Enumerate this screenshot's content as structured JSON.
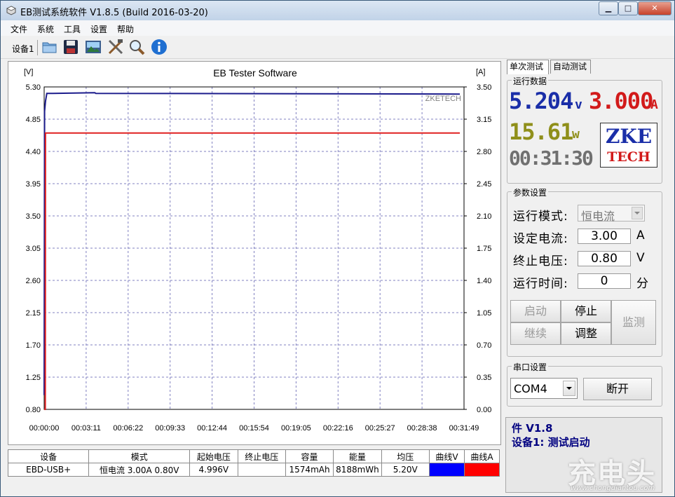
{
  "window": {
    "title": "EB测试系统软件 V1.8.5 (Build 2016-03-20)",
    "controls": {
      "minimize": "▁",
      "maximize": "□",
      "close": "✕"
    }
  },
  "menu": [
    "文件",
    "系统",
    "工具",
    "设置",
    "帮助"
  ],
  "toolbar": {
    "device_label": "设备1",
    "icons": [
      "open-folder-icon",
      "save-disk-icon",
      "picture-icon",
      "tools-icon",
      "magnifier-icon",
      "info-icon"
    ]
  },
  "chart_data": {
    "type": "line",
    "title": "EB Tester Software",
    "watermark": "ZKETECH",
    "left_axis": {
      "unit": "[V]",
      "ticks": [
        "5.30",
        "4.85",
        "4.40",
        "3.95",
        "3.50",
        "3.05",
        "2.60",
        "2.15",
        "1.70",
        "1.25",
        "0.80"
      ],
      "range": [
        0.8,
        5.3
      ]
    },
    "right_axis": {
      "unit": "[A]",
      "ticks": [
        "3.50",
        "3.15",
        "2.80",
        "2.45",
        "2.10",
        "1.75",
        "1.40",
        "1.05",
        "0.70",
        "0.35",
        "0.00"
      ],
      "range": [
        0.0,
        3.5
      ]
    },
    "x_ticks": [
      "00:00:00",
      "00:03:11",
      "00:06:22",
      "00:09:33",
      "00:12:44",
      "00:15:54",
      "00:19:05",
      "00:22:16",
      "00:25:27",
      "00:28:38",
      "00:31:49"
    ],
    "x_range_seconds": [
      0,
      1909
    ],
    "series": [
      {
        "axis": "left",
        "color": "#1c1c8c",
        "points": [
          [
            0,
            1.0
          ],
          [
            2,
            4.96
          ],
          [
            6,
            5.1
          ],
          [
            12,
            5.21
          ],
          [
            40,
            5.21
          ],
          [
            230,
            5.22
          ],
          [
            235,
            5.21
          ],
          [
            1890,
            5.2
          ]
        ]
      },
      {
        "axis": "right",
        "color": "#e02020",
        "points": [
          [
            0,
            0.0
          ],
          [
            5,
            0.0
          ],
          [
            6,
            3.0
          ],
          [
            1890,
            3.0
          ]
        ]
      }
    ]
  },
  "table": {
    "headers": [
      "设备",
      "模式",
      "起始电压",
      "终止电压",
      "容量",
      "能量",
      "均压",
      "曲线V",
      "曲线A"
    ],
    "row": [
      "EBD-USB+",
      "恒电流  3.00A  0.80V",
      "4.996V",
      "",
      "1574mAh",
      "8188mWh",
      "5.20V",
      "",
      ""
    ],
    "curve_colors": {
      "v": "#0000ff",
      "a": "#ff0000"
    }
  },
  "right_panel": {
    "tabs": [
      "单次测试",
      "自动测试"
    ],
    "run_data": {
      "title": "运行数据",
      "voltage": "5.204",
      "voltage_unit": "v",
      "current": "3.000",
      "current_unit": "A",
      "power": "15.61",
      "power_unit": "w",
      "time": "00:31:30",
      "logo_line1": "ZKE",
      "logo_line2": "TECH"
    },
    "params": {
      "title": "参数设置",
      "mode_label": "运行模式:",
      "mode_value": "恒电流",
      "current_label": "设定电流:",
      "current_value": "3.00",
      "current_unit": "A",
      "cutoff_label": "终止电压:",
      "cutoff_value": "0.80",
      "cutoff_unit": "V",
      "time_label": "运行时间:",
      "time_value": "0",
      "time_unit": "分",
      "buttons": {
        "start": "启动",
        "stop": "停止",
        "monitor": "监测",
        "continue": "继续",
        "adjust": "调整"
      }
    },
    "serial": {
      "title": "串口设置",
      "port": "COM4",
      "disconnect": "断开"
    },
    "status": {
      "line1": "件 V1.8",
      "line2": "设备1: 测试启动"
    },
    "brand": {
      "name": "充电头",
      "url": "www.chongdiantou.com"
    }
  }
}
